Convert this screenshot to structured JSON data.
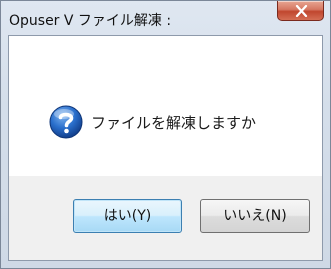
{
  "window": {
    "title": "Opuser V ファイル解凍 :"
  },
  "message": {
    "text": "ファイルを解凍しますか",
    "icon": "question-icon"
  },
  "buttons": {
    "yes_label": "はい(Y)",
    "no_label": "いいえ(N)"
  },
  "colors": {
    "close_button": "#c0462e",
    "default_button_border": "#3c7fb1",
    "icon_blue": "#1f5fb8"
  }
}
